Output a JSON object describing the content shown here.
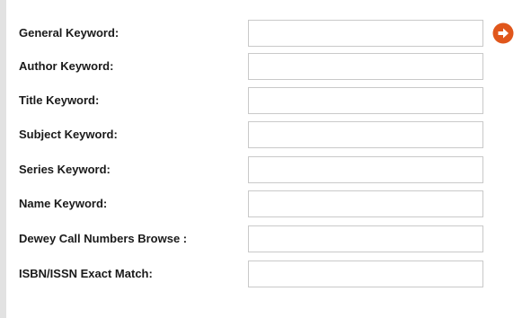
{
  "search_form": {
    "fields": [
      {
        "label": "General Keyword:",
        "value": "",
        "placeholder": ""
      },
      {
        "label": "Author Keyword:",
        "value": "",
        "placeholder": ""
      },
      {
        "label": "Title Keyword:",
        "value": "",
        "placeholder": ""
      },
      {
        "label": "Subject Keyword:",
        "value": "",
        "placeholder": ""
      },
      {
        "label": "Series Keyword:",
        "value": "",
        "placeholder": ""
      },
      {
        "label": "Name Keyword:",
        "value": "",
        "placeholder": ""
      },
      {
        "label": "Dewey Call Numbers Browse :",
        "value": "",
        "placeholder": ""
      },
      {
        "label": "ISBN/ISSN Exact Match:",
        "value": "",
        "placeholder": ""
      }
    ],
    "go_button": {
      "icon": "arrow-right-circle-icon",
      "color": "#e0561b"
    }
  },
  "colors": {
    "left_bar": "#e2e2e2",
    "field_border": "#c9c9c9",
    "label_text": "#1a1a1a",
    "go_button": "#e0561b"
  }
}
